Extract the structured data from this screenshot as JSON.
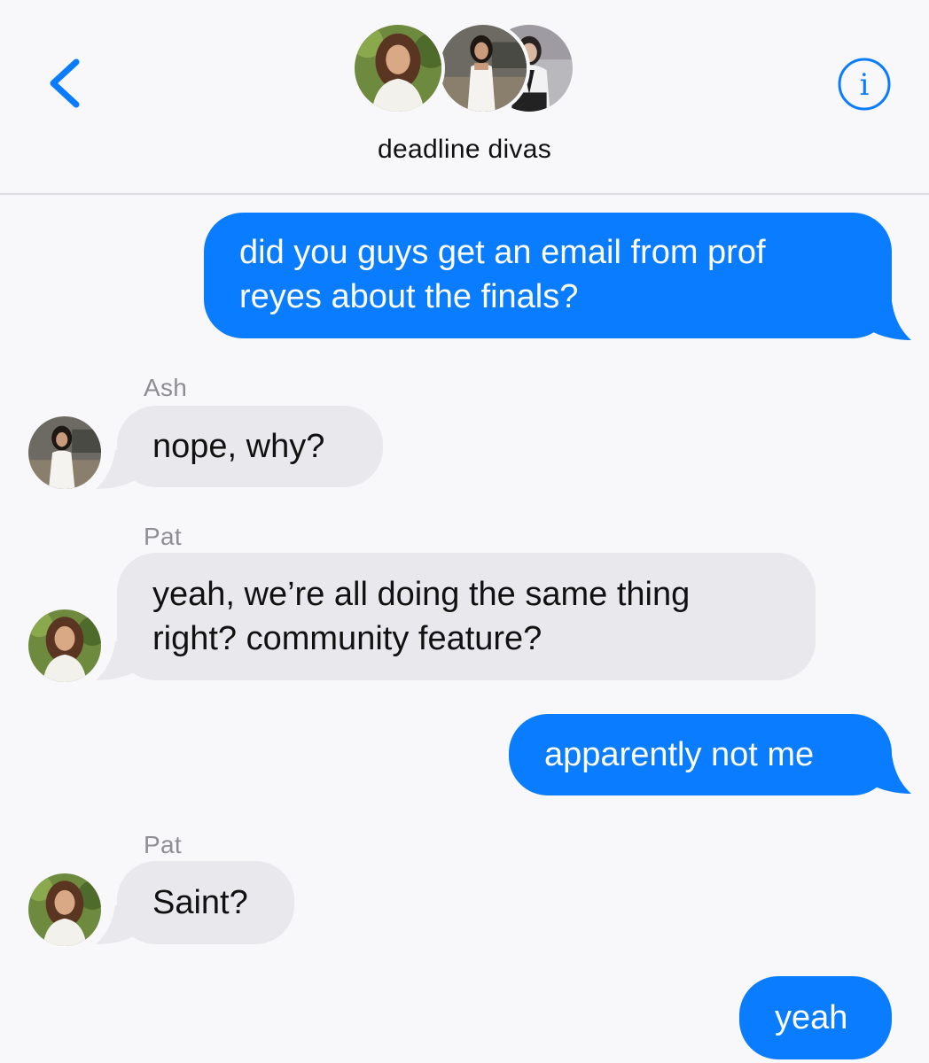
{
  "header": {
    "group_name": "deadline divas",
    "back_icon": "chevron-left-icon",
    "info_icon": "info-circle-icon",
    "accent_color": "#0a7cff"
  },
  "participants": [
    {
      "avatar": "avatar-pat"
    },
    {
      "avatar": "avatar-ash"
    },
    {
      "avatar": "avatar-third"
    }
  ],
  "messages": [
    {
      "direction": "outgoing",
      "lines": [
        "did you guys get an email from prof",
        "reyes about the finals?"
      ]
    },
    {
      "direction": "incoming",
      "sender": "Ash",
      "lines": [
        "nope, why?"
      ]
    },
    {
      "direction": "incoming",
      "sender": "Pat",
      "lines": [
        "yeah, we’re all doing the same thing",
        "right? community feature?"
      ]
    },
    {
      "direction": "outgoing",
      "lines": [
        "apparently not me"
      ]
    },
    {
      "direction": "incoming",
      "sender": "Pat",
      "lines": [
        "Saint?"
      ]
    },
    {
      "direction": "outgoing",
      "lines": [
        "yeah"
      ]
    }
  ],
  "colors": {
    "outgoing_bubble": "#0a7cff",
    "incoming_bubble": "#e9e9ed",
    "background": "#f8f8fa"
  }
}
